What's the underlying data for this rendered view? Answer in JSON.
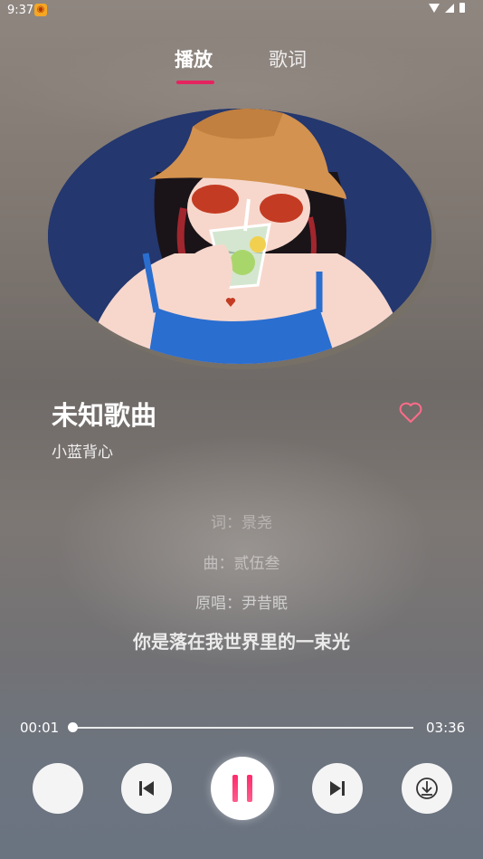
{
  "status_bar": {
    "time": "9:37"
  },
  "tabs": [
    {
      "label": "播放"
    },
    {
      "label": "歌词"
    }
  ],
  "song": {
    "title": "未知歌曲",
    "artist": "小蓝背心"
  },
  "lyrics": [
    "词：景尧",
    "曲：贰伍叁",
    "原唱：尹昔眠",
    "你是落在我世界里的一束光"
  ],
  "player": {
    "current_time": "00:01",
    "total_time": "03:36",
    "progress": 0.005
  },
  "colors": {
    "accent": "#e5245f",
    "heart": "#ff6b8a"
  },
  "icons": {
    "mode": "mode-icon",
    "prev": "skip-previous-icon",
    "play": "pause-icon",
    "next": "skip-next-icon",
    "download": "download-icon",
    "favorite": "heart-icon"
  }
}
